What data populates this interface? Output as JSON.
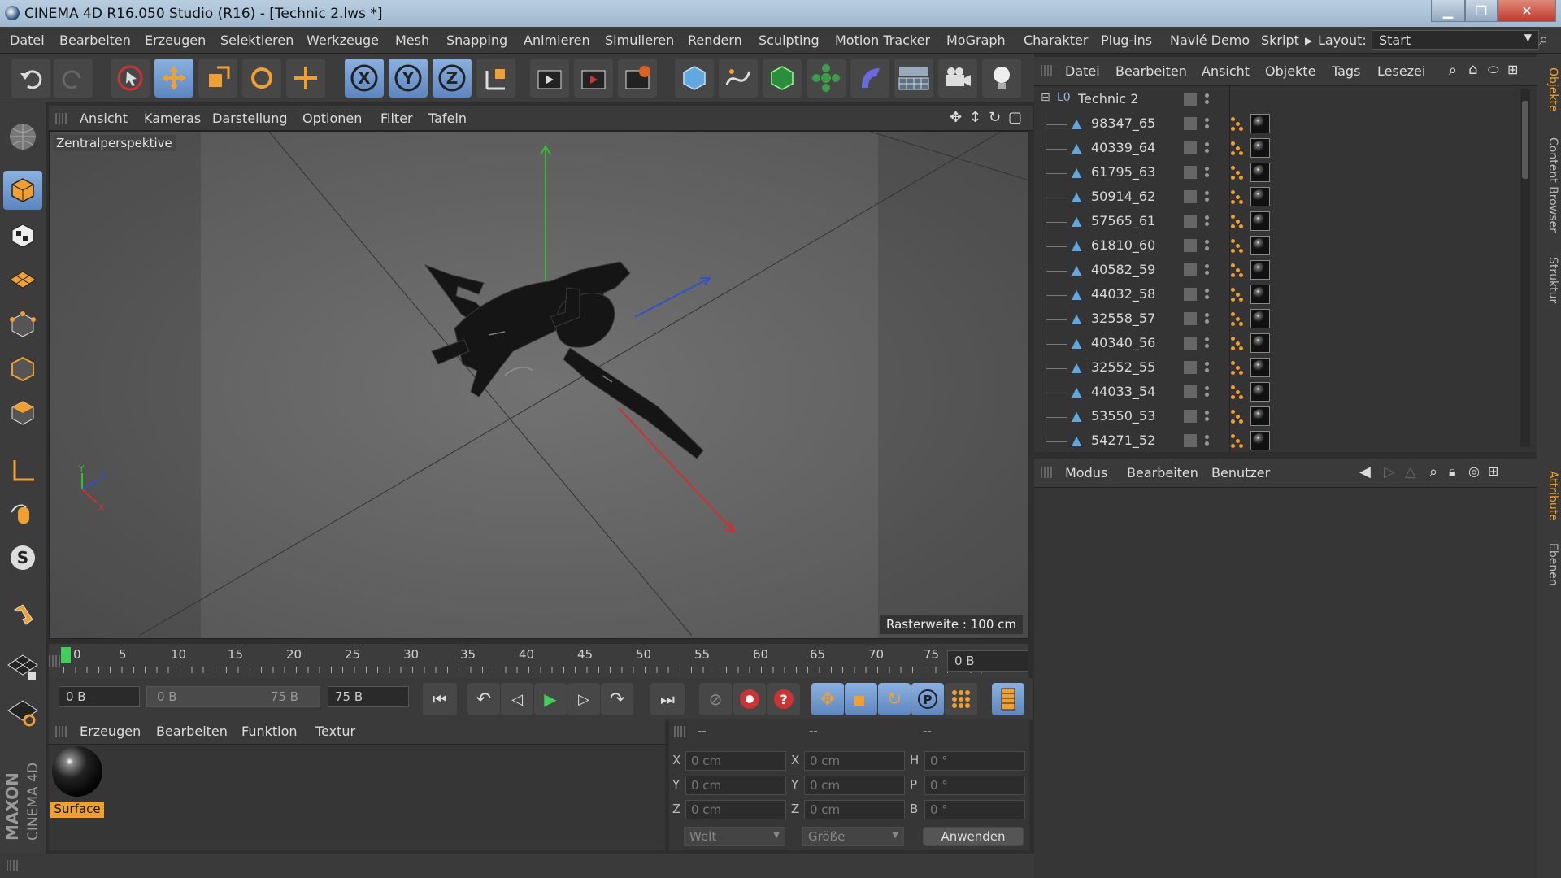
{
  "window": {
    "title": "CINEMA 4D R16.050 Studio (R16) - [Technic 2.lws *]"
  },
  "menubar": {
    "items": [
      "Datei",
      "Bearbeiten",
      "Erzeugen",
      "Selektieren",
      "Werkzeuge",
      "Mesh",
      "Snapping",
      "Animieren",
      "Simulieren",
      "Rendern",
      "Sculpting",
      "Motion Tracker",
      "MoGraph",
      "Charakter",
      "Plug-ins",
      "Navié Demo",
      "Skript"
    ],
    "layout_label": "Layout:",
    "layout_value": "Start"
  },
  "viewport": {
    "menu": [
      "Ansicht",
      "Kameras",
      "Darstellung",
      "Optionen",
      "Filter",
      "Tafeln"
    ],
    "camera_label": "Zentralperspektive",
    "grid_label": "Rasterweite : 100 cm"
  },
  "timeline": {
    "ticks": [
      "0",
      "5",
      "10",
      "15",
      "20",
      "25",
      "30",
      "35",
      "40",
      "45",
      "50",
      "55",
      "60",
      "65",
      "70",
      "75"
    ],
    "current_frame": "0 B",
    "start_field": "0 B",
    "range_start": "0 B",
    "range_end": "75 B",
    "end_field": "75 B"
  },
  "material_manager": {
    "menu": [
      "Erzeugen",
      "Bearbeiten",
      "Funktion",
      "Textur"
    ],
    "material_name": "Surface"
  },
  "coordinates": {
    "headers": [
      "--",
      "--",
      "--"
    ],
    "rows": [
      {
        "a": "X",
        "av": "0 cm",
        "b": "X",
        "bv": "0 cm",
        "c": "H",
        "cv": "0 °"
      },
      {
        "a": "Y",
        "av": "0 cm",
        "b": "Y",
        "bv": "0 cm",
        "c": "P",
        "cv": "0 °"
      },
      {
        "a": "Z",
        "av": "0 cm",
        "b": "Z",
        "bv": "0 cm",
        "c": "B",
        "cv": "0 °"
      }
    ],
    "mode_select": "Welt",
    "size_select": "Größe",
    "apply_button": "Anwenden"
  },
  "object_manager": {
    "menu": [
      "Datei",
      "Bearbeiten",
      "Ansicht",
      "Objekte",
      "Tags",
      "Lesezei"
    ],
    "root": "Technic 2",
    "objects": [
      "98347_65",
      "40339_64",
      "61795_63",
      "50914_62",
      "57565_61",
      "61810_60",
      "40582_59",
      "44032_58",
      "32558_57",
      "40340_56",
      "32552_55",
      "44033_54",
      "53550_53",
      "54271_52"
    ]
  },
  "attribute_manager": {
    "menu": [
      "Modus",
      "Bearbeiten",
      "Benutzer"
    ]
  },
  "right_tabs": [
    "Objekte",
    "Content Browser",
    "Struktur",
    "Attribute",
    "Ebenen"
  ],
  "branding": {
    "maxon": "MAXON",
    "product": "CINEMA 4D"
  },
  "colors": {
    "accent": "#f0a030",
    "selected_tool": "#6f97cf",
    "axis_x": "#d03030",
    "axis_y": "#30c030",
    "axis_z": "#3050d0"
  }
}
